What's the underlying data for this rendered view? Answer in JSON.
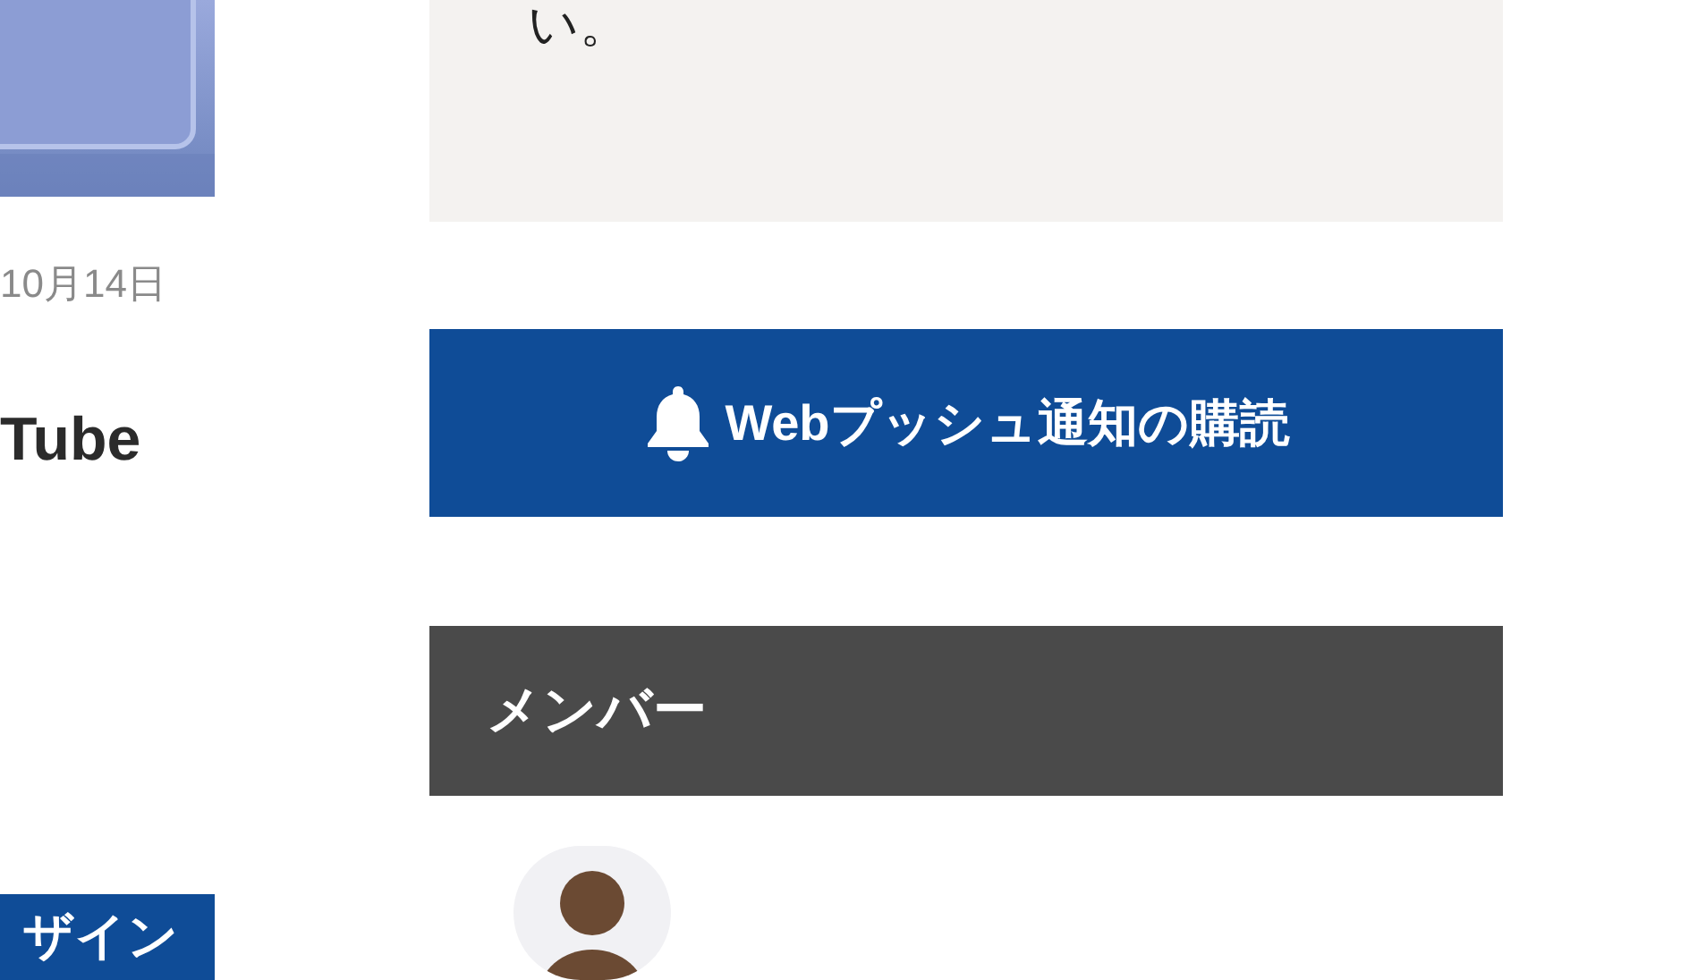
{
  "left_column": {
    "date": "10月14日",
    "title": "Tube",
    "category_badge": "ザイン"
  },
  "sidebar": {
    "notice_text": "い。",
    "push_button": {
      "label": "Webプッシュ通知の購読"
    },
    "members": {
      "heading": "メンバー"
    }
  }
}
